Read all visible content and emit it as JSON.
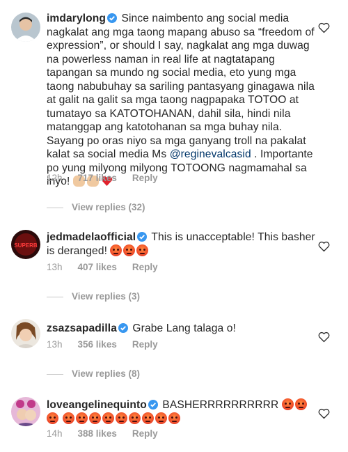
{
  "comments": [
    {
      "username": "imdarylong",
      "text_before_mention": "Since naimbento ang social media nagkalat ang mga taong mapang abuso sa “freedom of expression”, or should I say, nagkalat ang mga duwag na powerless naman in real life at nagtatapang tapangan sa mundo ng social media, eto yung mga taong nabubuhay sa sariling pantasyang ginagawa nila at galit na galit sa mga taong nagpapaka TOTOO at tumatayo sa KATOTOHANAN, dahil sila, hindi nila matanggap ang katotohanan sa mga buhay nila. Sayang po oras niyo sa mga ganyang troll na pakalat kalat sa social media Ms",
      "mention": "@reginevalcasid",
      "text_after_mention": ". Importante po yung milyong milyong TOTOONG nagmamahal sa inyo!",
      "emoji": [
        "punch-emoji",
        "raised-hands-emoji",
        "red-heart-emoji"
      ],
      "time": "12h",
      "likes": "717 likes",
      "reply": "Reply",
      "view_replies": "View replies (32)"
    },
    {
      "username": "jedmadelaofficial",
      "text": "This is unacceptable! This basher is deranged!",
      "emoji_count": 3,
      "time": "13h",
      "likes": "407 likes",
      "reply": "Reply",
      "view_replies": "View replies (3)",
      "avatar_text": "SUPERB"
    },
    {
      "username": "zsazsapadilla",
      "text": "Grabe Lang talaga o!",
      "time": "13h",
      "likes": "356 likes",
      "reply": "Reply",
      "view_replies": "View replies (8)"
    },
    {
      "username": "loveangelinequinto",
      "text": "BASHERRRRRRRRRR",
      "emoji_count": 12,
      "time": "14h",
      "likes": "388 likes",
      "reply": "Reply"
    }
  ],
  "colors": {
    "verified": "#3897f0",
    "meta": "#999999",
    "mention": "#003569",
    "text": "#262626"
  },
  "icons": {
    "like": "heart-outline-icon",
    "verified": "verified-badge-icon"
  }
}
